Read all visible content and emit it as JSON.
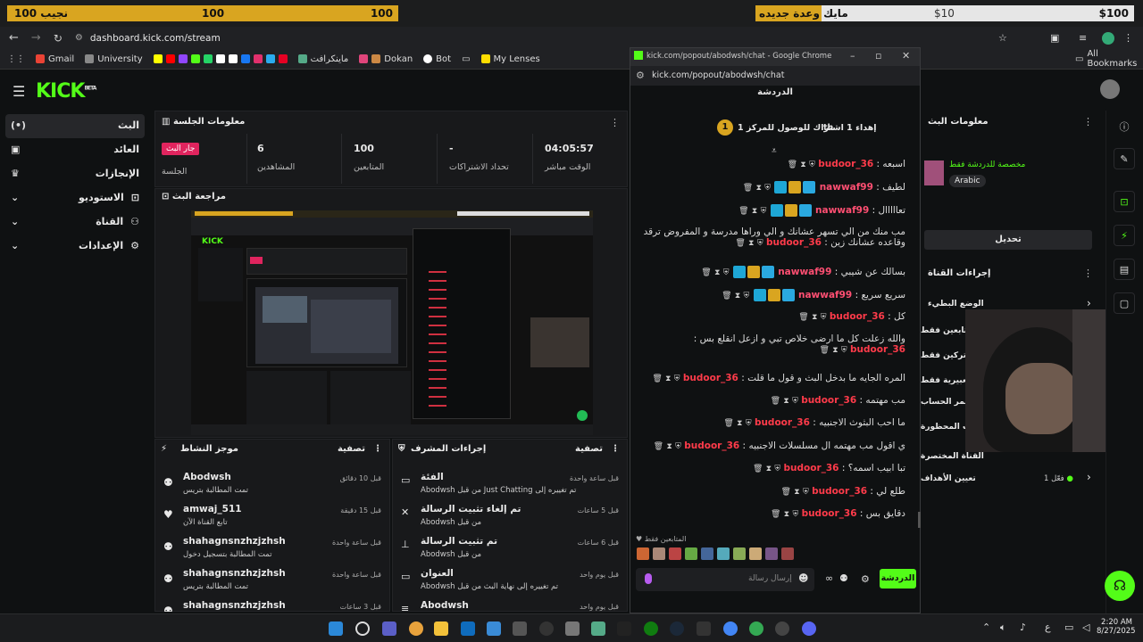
{
  "top_strip": {
    "left_label": "نجيب 100",
    "left_amount1": "100",
    "left_amount2": "100",
    "right_label": "مايك وعدة جديده",
    "right_amount1": "$10",
    "right_amount2": "$100"
  },
  "browser": {
    "url": "dashboard.kick.com/stream",
    "bookmarks": [
      "Gmail",
      "University",
      "ماينكرافت",
      "Dokan",
      "Bot",
      "My Lenses"
    ],
    "all_bookmarks": "All Bookmarks"
  },
  "sidebar": {
    "items": [
      {
        "label": "البث",
        "icon": "broadcast-icon"
      },
      {
        "label": "العائد",
        "icon": "money-icon"
      },
      {
        "label": "الإنجازات",
        "icon": "trophy-icon"
      },
      {
        "label": "الاستوديو",
        "icon": "studio-icon"
      },
      {
        "label": "القناة",
        "icon": "channel-icon"
      },
      {
        "label": "الإعدادات",
        "icon": "gear-icon"
      }
    ]
  },
  "session": {
    "title": "معلومات الجلسة",
    "live_badge": "جار البث",
    "live_label": "الجلسة",
    "stats": [
      {
        "value": "04:05:57",
        "label": "الوقت مباشر"
      },
      {
        "value": "-",
        "label": "تحداد الاشتراكات"
      },
      {
        "value": "100",
        "label": "المتابعين"
      },
      {
        "value": "6",
        "label": "المشاهدين"
      }
    ]
  },
  "preview": {
    "title": "مراجعة البث"
  },
  "activity": {
    "title": "موجز النشاط",
    "filter": "تصفية",
    "items": [
      {
        "name": "Abodwsh",
        "desc": "تمت المطالبة بتريس",
        "time": "قبل 10 دقائق"
      },
      {
        "name": "amwaj_511",
        "desc": "تابع القناة الآن",
        "time": "قبل 15 دقيقة"
      },
      {
        "name": "shahagnsnzhzjzhsh",
        "desc": "تمت المطالبة بتسجيل دخول",
        "time": "قبل ساعة واحدة"
      },
      {
        "name": "shahagnsnzhzjzhsh",
        "desc": "تمت المطالبة بتريس",
        "time": "قبل ساعة واحدة"
      },
      {
        "name": "shahagnsnzhzjzhsh",
        "desc": "",
        "time": "قبل 3 ساعات"
      }
    ]
  },
  "mod": {
    "title": "إجراءات المشرف",
    "filter": "تصفية",
    "items": [
      {
        "name": "الفئة",
        "desc": "Abodwsh من قبل Just Chatting تم تغييره إلى",
        "time": "قبل ساعة واحدة"
      },
      {
        "name": "تم إلغاء تثبيت الرسالة",
        "desc": "Abodwsh من قبل",
        "time": "قبل 5 ساعات"
      },
      {
        "name": "تم تثبيت الرسالة",
        "desc": "Abodwsh من قبل",
        "time": "قبل 6 ساعات"
      },
      {
        "name": "العنوان",
        "desc": "Abodwsh تم تغييره إلى نهاية البث من قبل",
        "time": "قبل يوم واحد"
      },
      {
        "name": "Abodwsh",
        "desc": "",
        "time": "قبل يوم واحد"
      }
    ]
  },
  "chat_window": {
    "window_title": "kick.com/popout/abodwsh/chat - Google Chrome",
    "url": "kick.com/popout/abodwsh/chat",
    "header": "الدردشة",
    "pinned": "إهداء 1 اشتراك للوصول للمركز 1",
    "pinned_suffix": "th",
    "pinned_rank": "1",
    "messages": [
      {
        "user": "budoor_36",
        "text": "اسبعه",
        "style": "plain"
      },
      {
        "user": "nawwaf99",
        "text": "لطيف",
        "style": "badges"
      },
      {
        "user": "nawwaf99",
        "text": "تعااااال",
        "style": "badges"
      },
      {
        "user": "budoor_36",
        "text": "مب منك من الي تسهر عشانك و الي وراها مدرسة و المفروض ترقد وقاعده عشانك زين",
        "style": "plain"
      },
      {
        "user": "nawwaf99",
        "text": "بسالك عن شيبي",
        "style": "badges"
      },
      {
        "user": "nawwaf99",
        "text": "سريع سريع",
        "style": "badges"
      },
      {
        "user": "budoor_36",
        "text": "كل",
        "style": "plain"
      },
      {
        "user": "budoor_36",
        "text": "والله زعلت كل ما ارضى خلاص تبي و ازعل انقلع بس",
        "style": "plain"
      },
      {
        "user": "budoor_36",
        "text": "المره الجايه ما بدخل البث و قول ما قلت",
        "style": "plain"
      },
      {
        "user": "budoor_36",
        "text": "مب مهتمه",
        "style": "plain"
      },
      {
        "user": "budoor_36",
        "text": "ما احب البثوث الاجنبيه",
        "style": "plain"
      },
      {
        "user": "budoor_36",
        "text": "ي اقول مب مهتمه ال مسلسلات الاجنبيه",
        "style": "plain"
      },
      {
        "user": "budoor_36",
        "text": "تبا ابيب اسمه؟",
        "style": "plain"
      },
      {
        "user": "budoor_36",
        "text": "طلع لي",
        "style": "plain"
      },
      {
        "user": "budoor_36",
        "text": "دقايق بس",
        "style": "plain"
      }
    ],
    "followers_label": "المتابعين فقط",
    "input_placeholder": "إرسال رسالة",
    "send_button": "الدردشة"
  },
  "right_panel": {
    "title": "معلومات البث",
    "tag": "مخصصة للدردشة فقط",
    "language": "Arabic",
    "edit_button": "تحديل",
    "actions_title": "إجراءات القناة",
    "actions": [
      "الوضع البطيء",
      "المتابعين فقط",
      "المشتركين فقط",
      "الرموز التعبيرية فقط",
      "الحد الأدنى لعمر الحساب",
      "الكلمات المحظورة"
    ],
    "shortcuts_title": "القناة المختصرة",
    "goals": "تعيين الأهداف",
    "goals_count": "فعّل 1"
  },
  "taskbar": {
    "time": "2:20 AM",
    "date": "8/27/2025",
    "lang": "ع"
  },
  "colors": {
    "kick_green": "#53fc18",
    "username_red": "#ff3b4a",
    "gold": "#d9a520"
  }
}
